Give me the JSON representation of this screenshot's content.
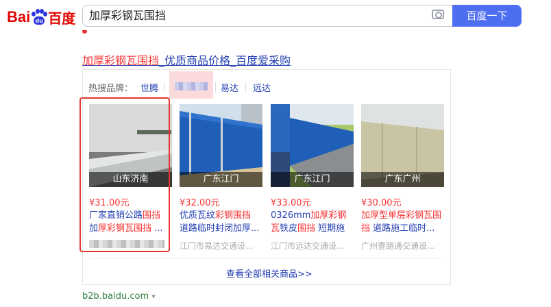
{
  "header": {
    "logo_part1": "Bai",
    "logo_paw": "du",
    "logo_part2": "百度",
    "search_value": "加厚彩钢瓦围挡",
    "search_button": "百度一下",
    "camera_icon": "camera-icon"
  },
  "result": {
    "title_highlight": "加厚彩钢瓦围挡",
    "title_rest": "_优质商品价格_百度爱采购",
    "brands_label": "热搜品牌：",
    "brands": [
      "世腾",
      "易达",
      "远达"
    ],
    "products": [
      {
        "location": "山东济南",
        "price": "¥31.00元",
        "desc_a": "厂家直销公路",
        "desc_hl1": "围挡",
        "desc_b": " 加",
        "desc_hl2": "厚彩钢瓦围挡",
        "desc_c": " ...",
        "shop": ""
      },
      {
        "location": "广东江门",
        "price": "¥32.00元",
        "desc_a": "优质瓦纹",
        "desc_hl1": "彩钢围挡",
        "desc_b": " 道路临时封闭加厚...",
        "desc_hl2": "",
        "desc_c": "",
        "shop": "江门市易达交通设..."
      },
      {
        "location": "广东江门",
        "price": "¥33.00元",
        "desc_a": "0326mm",
        "desc_hl1": "加厚彩钢瓦",
        "desc_b": "铁皮",
        "desc_hl2": "围挡",
        "desc_c": " 短期施工...",
        "shop": "江门市远达交通设..."
      },
      {
        "location": "广东广州",
        "price": "¥30.00元",
        "desc_a": "",
        "desc_hl1": "加厚型单层彩钢瓦围挡",
        "desc_b": " 道路施工临时...",
        "desc_hl2": "",
        "desc_c": "",
        "shop": "广州壹路通交通设..."
      }
    ],
    "view_all": "查看全部相关商品>>",
    "source": "b2b.baidu.com",
    "source_arrow": "▾"
  }
}
